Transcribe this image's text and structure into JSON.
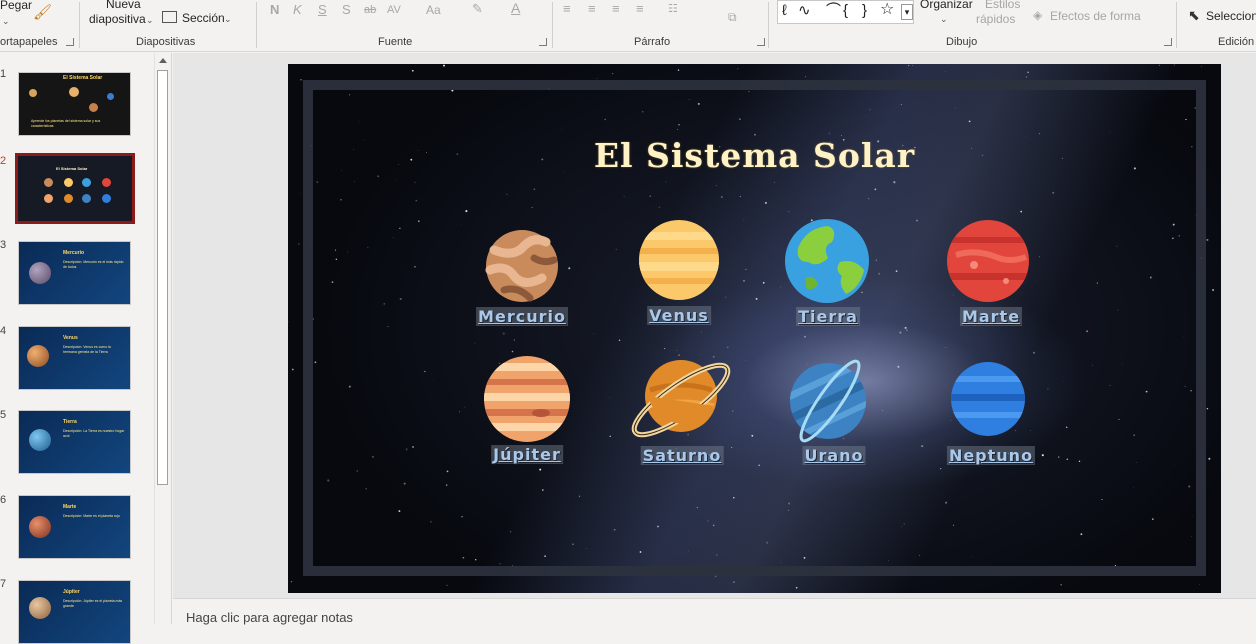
{
  "ribbon": {
    "clipboard": {
      "paste_label": "Pegar",
      "group_label": "ortapapeles"
    },
    "slides": {
      "new_slide_line1": "Nueva",
      "new_slide_line2": "diapositiva",
      "section_label": "Sección",
      "group_label": "Diapositivas"
    },
    "font": {
      "bold": "N",
      "italic": "K",
      "underline": "S",
      "shadow": "S",
      "strike": "ab",
      "spacing": "AV",
      "case": "Aa",
      "group_label": "Fuente"
    },
    "paragraph": {
      "group_label": "Párrafo"
    },
    "drawing": {
      "arrange_label": "Organizar",
      "quick_styles_line1": "Estilos",
      "quick_styles_line2": "rápidos",
      "shape_effects_label": "Efectos de forma",
      "group_label": "Dibujo"
    },
    "editing": {
      "select_label": "Seleccion",
      "group_label": "Edición"
    }
  },
  "thumbnails": [
    {
      "number": "1",
      "title": "El Sistema Solar",
      "caption": "Aprende los planetas del sistema solar y sus características",
      "active": false
    },
    {
      "number": "2",
      "title": "El Sistema Solar",
      "caption": "",
      "active": true
    },
    {
      "number": "3",
      "title": "Mercurio",
      "caption": "Descripción: Mercurio es el más rápido de todos",
      "active": false
    },
    {
      "number": "4",
      "title": "Venus",
      "caption": "Descripción: Venus es como la hermana gemela de la Tierra",
      "active": false
    },
    {
      "number": "5",
      "title": "Tierra",
      "caption": "Descripción: La Tierra es nuestro hogar azul",
      "active": false
    },
    {
      "number": "6",
      "title": "Marte",
      "caption": "Descripción: Marte es el planeta rojo",
      "active": false
    },
    {
      "number": "7",
      "title": "Júpiter",
      "caption": "Descripción: Júpiter es el planeta más grande",
      "active": false
    }
  ],
  "slide": {
    "title": "El Sistema Solar",
    "planets": [
      {
        "name": "Mercurio",
        "icon": "mercury-icon",
        "color": "#c98b5c"
      },
      {
        "name": "Venus",
        "icon": "venus-icon",
        "color": "#fbc96a"
      },
      {
        "name": "Tierra",
        "icon": "earth-icon",
        "color": "#3aa1e0"
      },
      {
        "name": "Marte",
        "icon": "mars-icon",
        "color": "#e2453b"
      },
      {
        "name": "Júpiter",
        "icon": "jupiter-icon",
        "color": "#f0a36b"
      },
      {
        "name": "Saturno",
        "icon": "saturn-icon",
        "color": "#e08a2a"
      },
      {
        "name": "Urano",
        "icon": "uranus-icon",
        "color": "#3d82c2"
      },
      {
        "name": "Neptuno",
        "icon": "neptune-icon",
        "color": "#2f7fe0"
      }
    ]
  },
  "notes": {
    "placeholder": "Haga clic para agregar notas"
  },
  "colors": {
    "accent": "#c43e1c",
    "title": "#fff2c6",
    "label": "#aac8ea"
  }
}
